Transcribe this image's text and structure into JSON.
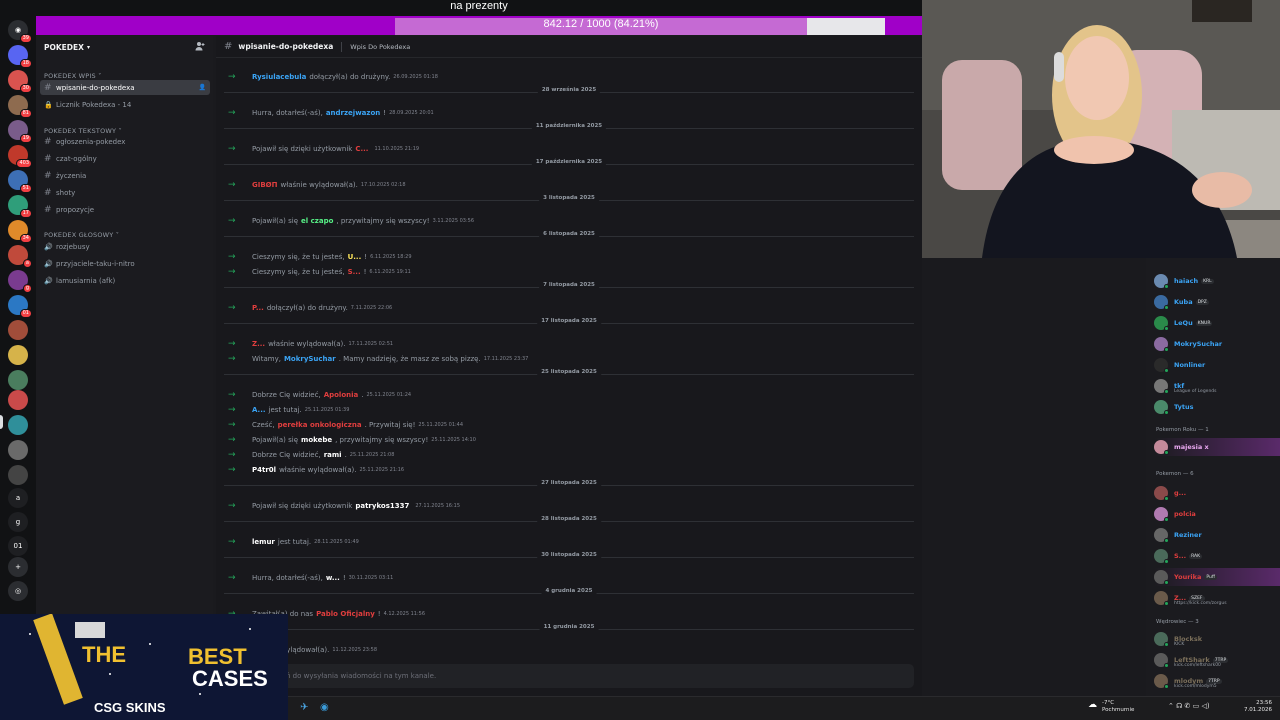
{
  "topbar": {
    "title": "na prezenty",
    "progress_label": "842.12 / 1000 (84.21%)",
    "progress_fraction": 0.8421
  },
  "server": {
    "name": "POKEDEX",
    "rail_badges": [
      "39",
      "18",
      "30",
      "81",
      "19",
      "403",
      "51",
      "17",
      "34",
      "a",
      "g",
      "01"
    ]
  },
  "sidebar": {
    "categories": [
      {
        "label": "POKEDEX Wpis"
      },
      {
        "label": "POKEDEX Tekstowy"
      },
      {
        "label": "POKEDEX GŁOSOWY"
      }
    ],
    "channels": [
      {
        "label": "wpisanie-do-pokedexa",
        "icon": "hash-icon",
        "active": true
      },
      {
        "label": "Licznik Pokedexa - 14",
        "icon": "lock-icon"
      },
      {
        "label": "ogłoszenia-pokedex",
        "icon": "hash-icon"
      },
      {
        "label": "czat-ogólny",
        "icon": "hash-icon"
      },
      {
        "label": "życzenia",
        "icon": "hash-icon"
      },
      {
        "label": "shoty",
        "icon": "hash-icon"
      },
      {
        "label": "propozycje",
        "icon": "hash-icon"
      },
      {
        "label": "rozjebusy",
        "icon": "speaker-icon"
      },
      {
        "label": "przyjaciele-taku-i-nitro",
        "icon": "speaker-icon"
      },
      {
        "label": "lamusiarnia (afk)",
        "icon": "speaker-icon"
      }
    ]
  },
  "channel": {
    "name": "wpisanie-do-pokedexa",
    "topic": "Wpis Do Pokedexa",
    "input_placeholder": "ń do wysyłania wiadomości na tym kanale."
  },
  "messages": [
    {
      "kind": "msg",
      "pre": "",
      "who": "Rysiulacebula",
      "color": "#3ba4f5",
      "post": "dołączył(a) do drużyny.",
      "ts": "26.09.2025 01:18"
    },
    {
      "kind": "date",
      "label": "28 września 2025"
    },
    {
      "kind": "msg",
      "pre": "Hurra, dotarłeś(-aś),",
      "who": "andrzejwazon",
      "color": "#3ba4f5",
      "post": "!",
      "ts": "28.09.2025 20:01"
    },
    {
      "kind": "date",
      "label": "11 października 2025"
    },
    {
      "kind": "msg",
      "pre": "Pojawił się dzięki użytkownik",
      "who": "C...",
      "color": "#e03e3e",
      "post": "",
      "ts": "11.10.2025 21:19"
    },
    {
      "kind": "date",
      "label": "17 października 2025"
    },
    {
      "kind": "msg",
      "pre": "",
      "who": "GIBØП",
      "color": "#e03e3e",
      "post": "właśnie wylądował(a).",
      "ts": "17.10.2025 02:18"
    },
    {
      "kind": "date",
      "label": "3 listopada 2025"
    },
    {
      "kind": "msg",
      "pre": "Pojawił(a) się",
      "who": "el czapo",
      "color": "#57f287",
      "post": ", przywitajmy się wszyscy!",
      "ts": "3.11.2025 03:56"
    },
    {
      "kind": "date",
      "label": "6 listopada 2025"
    },
    {
      "kind": "msg",
      "pre": "Cieszymy się, że tu jesteś,",
      "who": "U...",
      "color": "#fee75c",
      "post": "!",
      "ts": "6.11.2025 18:29"
    },
    {
      "kind": "msg",
      "pre": "Cieszymy się, że tu jesteś,",
      "who": "S...",
      "color": "#e03e3e",
      "post": "!",
      "ts": "6.11.2025 19:11"
    },
    {
      "kind": "date",
      "label": "7 listopada 2025"
    },
    {
      "kind": "msg",
      "pre": "",
      "who": "P...",
      "color": "#e03e3e",
      "post": "dołączył(a) do drużyny.",
      "ts": "7.11.2025 22:06"
    },
    {
      "kind": "date",
      "label": "17 listopada 2025"
    },
    {
      "kind": "msg",
      "pre": "",
      "who": "Z...",
      "color": "#e03e3e",
      "post": "właśnie wylądował(a).",
      "ts": "17.11.2025 02:51"
    },
    {
      "kind": "msg",
      "pre": "Witamy,",
      "who": "MokrySuchar",
      "color": "#3ba4f5",
      "post": ". Mamy nadzieję, że masz ze sobą pizzę.",
      "ts": "17.11.2025 23:37"
    },
    {
      "kind": "date",
      "label": "25 listopada 2025"
    },
    {
      "kind": "msg",
      "pre": "Dobrze Cię widzieć,",
      "who": "Apolonia",
      "color": "#e03e3e",
      "post": ".",
      "ts": "25.11.2025 01:24"
    },
    {
      "kind": "msg",
      "pre": "",
      "who": "A...",
      "color": "#3ba4f5",
      "post": "jest tutaj.",
      "ts": "25.11.2025 01:39"
    },
    {
      "kind": "msg",
      "pre": "Cześć,",
      "who": "perełka onkologiczna",
      "color": "#e03e3e",
      "post": ". Przywitaj się!",
      "ts": "25.11.2025 01:44"
    },
    {
      "kind": "msg",
      "pre": "Pojawił(a) się",
      "who": "mokebe",
      "color": "#ffffff",
      "post": ", przywitajmy się wszyscy!",
      "ts": "25.11.2025 14:10"
    },
    {
      "kind": "msg",
      "pre": "Dobrze Cię widzieć,",
      "who": "rami",
      "color": "#ffffff",
      "post": ".",
      "ts": "25.11.2025 21:08"
    },
    {
      "kind": "msg",
      "pre": "",
      "who": "P4tr0l",
      "color": "#ffffff",
      "post": "właśnie wylądował(a).",
      "ts": "25.11.2025 21:16"
    },
    {
      "kind": "date",
      "label": "27 listopada 2025"
    },
    {
      "kind": "msg",
      "pre": "Pojawił się dzięki użytkownik",
      "who": "patrykos1337",
      "color": "#ffffff",
      "post": "",
      "ts": "27.11.2025 16:15"
    },
    {
      "kind": "date",
      "label": "28 listopada 2025"
    },
    {
      "kind": "msg",
      "pre": "",
      "who": "lemur",
      "color": "#ffffff",
      "post": "jest tutaj.",
      "ts": "28.11.2025 01:49"
    },
    {
      "kind": "date",
      "label": "30 listopada 2025"
    },
    {
      "kind": "msg",
      "pre": "Hurra, dotarłeś(-aś),",
      "who": "w...",
      "color": "#ffffff",
      "post": "!",
      "ts": "30.11.2025 03:11"
    },
    {
      "kind": "date",
      "label": "4 grudnia 2025"
    },
    {
      "kind": "msg",
      "pre": "Zawitał(a) do nas",
      "who": "Pablo Oficjalny",
      "color": "#e03e3e",
      "post": "!",
      "ts": "4.12.2025 11:56"
    },
    {
      "kind": "date",
      "label": "11 grudnia 2025"
    },
    {
      "kind": "msg",
      "pre": "",
      "who": "",
      "color": "#ffffff",
      "post": "właśnie wylądował(a).",
      "ts": "11.12.2025 23:58"
    }
  ],
  "members": {
    "top": [
      {
        "name": "haiach",
        "color": "#3ba4f5",
        "tag": "KRL"
      },
      {
        "name": "Kuba",
        "color": "#3ba4f5",
        "tag": "DPZ"
      },
      {
        "name": "LeQu",
        "color": "#3ba4f5",
        "tag": "KNUR"
      },
      {
        "name": "MokrySuchar",
        "color": "#3ba4f5",
        "tag": ""
      },
      {
        "name": "Nonliner",
        "color": "#3ba4f5",
        "tag": ""
      },
      {
        "name": "tkf",
        "color": "#3ba4f5",
        "tag": "",
        "sub": "League of Legends"
      },
      {
        "name": "Tytus",
        "color": "#3ba4f5",
        "tag": ""
      }
    ],
    "groups": [
      {
        "label": "Pokemon Roku — 1",
        "items": [
          {
            "name": "majesia x",
            "color": "#e9a8f0",
            "tag": ""
          }
        ]
      },
      {
        "label": "Pokemon — 6",
        "items": [
          {
            "name": "g...",
            "color": "#e03e3e",
            "tag": ""
          },
          {
            "name": "polcia",
            "color": "#e03e3e",
            "tag": ""
          },
          {
            "name": "Reziner",
            "color": "#3ba4f5",
            "tag": ""
          },
          {
            "name": "S...",
            "color": "#e03e3e",
            "tag": "RAK"
          },
          {
            "name": "Yourika",
            "color": "#e03e3e",
            "tag": "Puff"
          },
          {
            "name": "Z...",
            "color": "#e03e3e",
            "tag": "SZEF",
            "sub": "https://kick.com/zorgus"
          }
        ]
      },
      {
        "label": "Wędrowiec — 3",
        "items": [
          {
            "name": "Blocksk",
            "color": "#7b6f5a",
            "tag": "",
            "sub": "KICK"
          },
          {
            "name": "LeftShark",
            "color": "#7b6f5a",
            "tag": "7TRP",
            "sub": "kick.com/leftshark00"
          },
          {
            "name": "mlodym",
            "color": "#7b6f5a",
            "tag": "7TRP",
            "sub": "kick.com/mlodym5"
          }
        ]
      }
    ]
  },
  "ad": {
    "line1": "THE",
    "line2": "BEST",
    "line3": "CASES",
    "brand": "CSG SKINS"
  },
  "taskbar": {
    "weather_temp": "-7°C",
    "weather_label": "Pochmurnie",
    "time": "23:56",
    "date": "7.01.2026"
  },
  "colors": {
    "accent": "#a000c8",
    "progress_fill": "#c56ad3",
    "online": "#23a55a"
  }
}
